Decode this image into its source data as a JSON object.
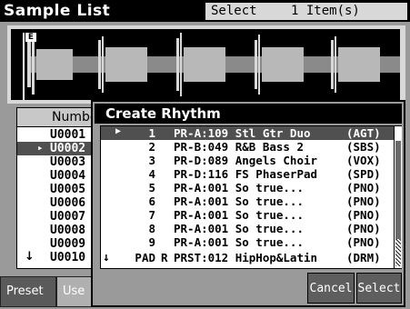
{
  "app": {
    "title": "Sample List"
  },
  "header": {
    "select_label": "Select",
    "select_count": "1 Item(s)"
  },
  "wave": {
    "marker": "E"
  },
  "sample_list": {
    "column_header": "Numbe",
    "rows": [
      "U0001",
      "U0002",
      "U0003",
      "U0004",
      "U0005",
      "U0006",
      "U0007",
      "U0008",
      "U0009",
      "U0010"
    ]
  },
  "tabs": {
    "preset": "Preset",
    "user": "Use"
  },
  "dialog": {
    "title": "Create Rhythm",
    "rows": [
      {
        "num": "1",
        "r": "",
        "tone": "PR-A:109 Stl Gtr Duo",
        "cat": "(AGT)"
      },
      {
        "num": "2",
        "r": "",
        "tone": "PR-B:049 R&B Bass 2",
        "cat": "(SBS)"
      },
      {
        "num": "3",
        "r": "",
        "tone": "PR-D:089 Angels Choir",
        "cat": "(VOX)"
      },
      {
        "num": "4",
        "r": "",
        "tone": "PR-D:116 FS PhaserPad",
        "cat": "(SPD)"
      },
      {
        "num": "5",
        "r": "",
        "tone": "PR-A:001 So true...",
        "cat": "(PNO)"
      },
      {
        "num": "6",
        "r": "",
        "tone": "PR-A:001 So true...",
        "cat": "(PNO)"
      },
      {
        "num": "7",
        "r": "",
        "tone": "PR-A:001 So true...",
        "cat": "(PNO)"
      },
      {
        "num": "8",
        "r": "",
        "tone": "PR-A:001 So true...",
        "cat": "(PNO)"
      },
      {
        "num": "9",
        "r": "",
        "tone": "PR-A:001 So true...",
        "cat": "(PNO)"
      },
      {
        "num": "PAD",
        "r": "R",
        "tone": "PRST:012 HipHop&Latin",
        "cat": "(DRM)"
      }
    ],
    "cancel_label": "Cancel",
    "select_label": "Select"
  },
  "colors": {
    "title_bg": "#000000",
    "highlight": "#505050",
    "button": "#5e5e5e"
  }
}
